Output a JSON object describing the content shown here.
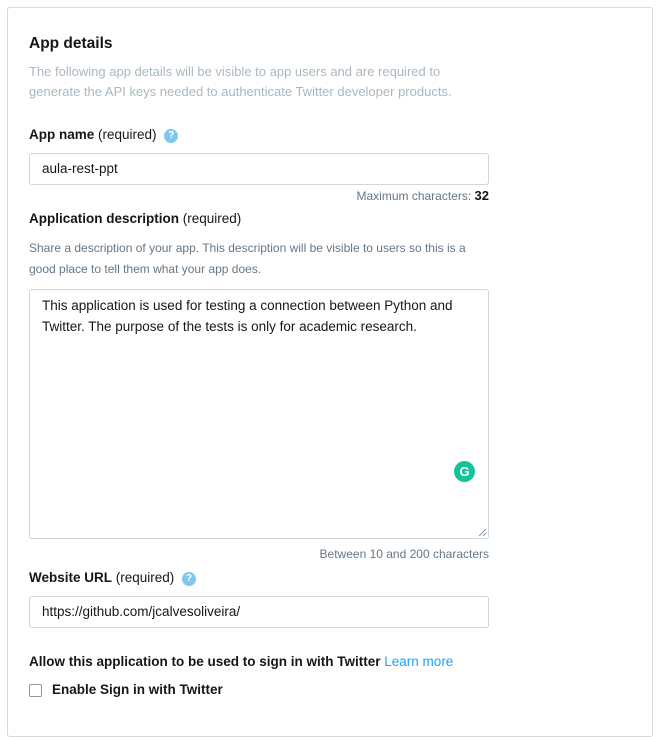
{
  "section": {
    "title": "App details",
    "subtitle": "The following app details will be visible to app users and are required to generate the API keys needed to authenticate Twitter developer products."
  },
  "app_name": {
    "label": "App name",
    "required": "(required)",
    "help_icon": "question-icon",
    "value": "aula-rest-ppt",
    "max_chars_label": "Maximum characters:",
    "max_chars_value": "32"
  },
  "app_description": {
    "label": "Application description",
    "required": "(required)",
    "help_text": "Share a description of your app. This description will be visible to users so this is a good place to tell them what your app does.",
    "value": "This application is used for testing a connection between Python and Twitter. The purpose of the tests is only for academic research.",
    "char_range": "Between 10 and 200 characters",
    "grammarly_icon": "grammarly-icon"
  },
  "website_url": {
    "label": "Website URL",
    "required": "(required)",
    "help_icon": "question-icon",
    "value": "https://github.com/jcalvesoliveira/"
  },
  "sign_in": {
    "heading": "Allow this application to be used to sign in with Twitter",
    "learn_more": "Learn more",
    "checkbox_label": "Enable Sign in with Twitter",
    "checked": false
  },
  "colors": {
    "accent": "#1da1f2",
    "help_icon": "#7dc8ee",
    "grammarly": "#15c39a"
  }
}
